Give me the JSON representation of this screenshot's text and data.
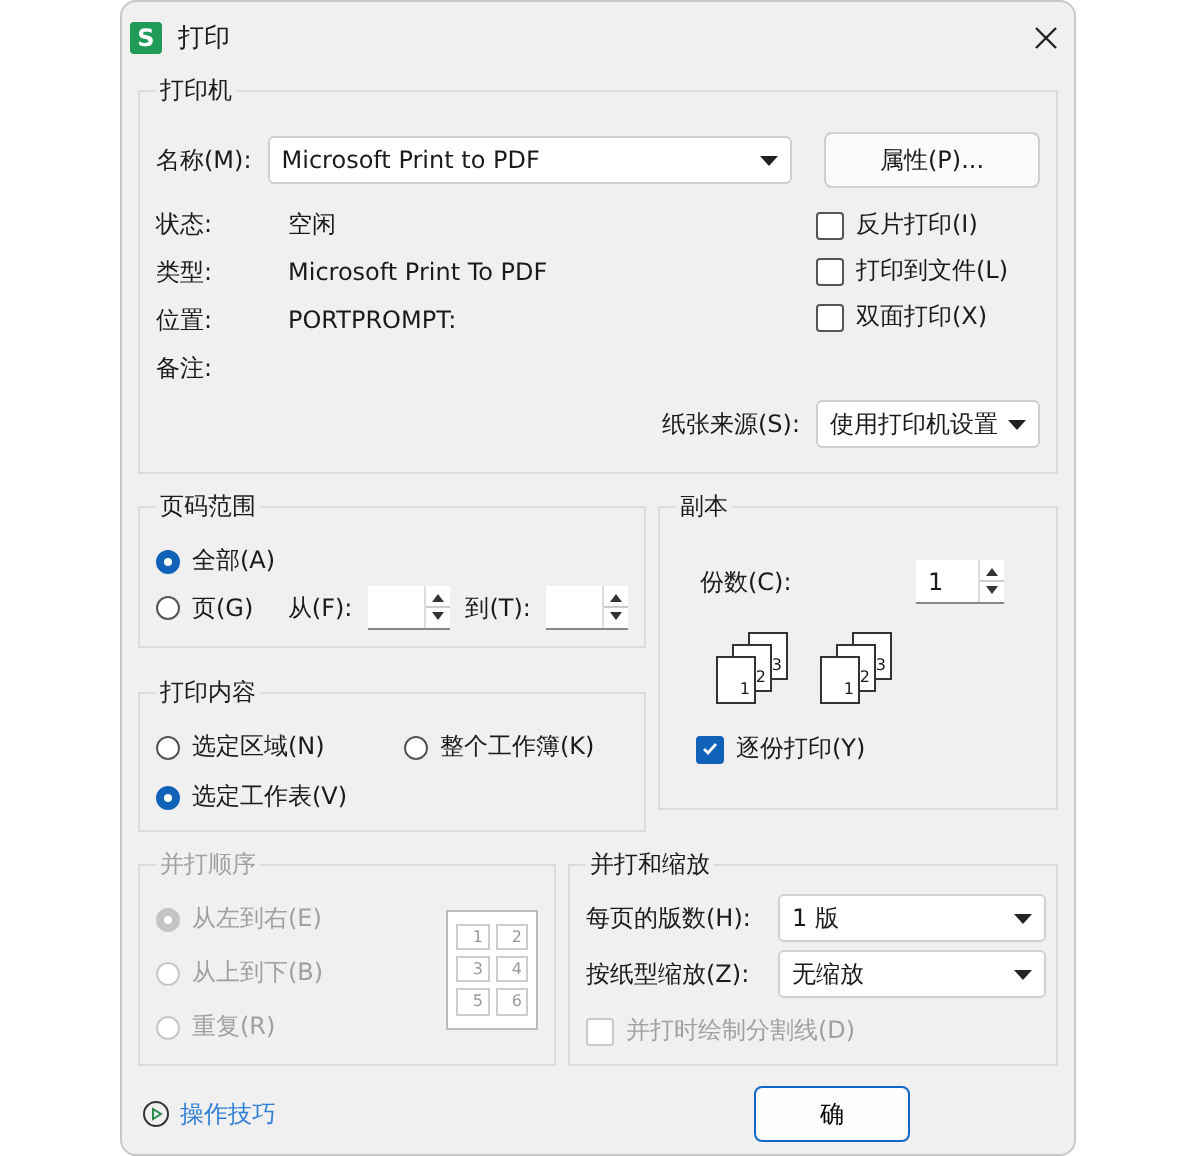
{
  "window": {
    "title": "打印",
    "app_icon": "S"
  },
  "printer": {
    "legend": "打印机",
    "name_label": "名称(M):",
    "name_value": "Microsoft Print to PDF",
    "properties_button": "属性(P)...",
    "info": [
      {
        "label": "状态:",
        "value": "空闲"
      },
      {
        "label": "类型:",
        "value": "Microsoft Print To PDF"
      },
      {
        "label": "位置:",
        "value": "PORTPROMPT:"
      },
      {
        "label": "备注:"
      }
    ],
    "options": [
      {
        "label": "反片打印(I)",
        "checked": false
      },
      {
        "label": "打印到文件(L)",
        "checked": false
      },
      {
        "label": "双面打印(X)",
        "checked": false
      }
    ],
    "paper_source_label": "纸张来源(S):",
    "paper_source_value": "使用打印机设置"
  },
  "page_range": {
    "legend": "页码范围",
    "options": [
      {
        "label": "全部(A)",
        "selected": true
      },
      {
        "label": "页(G)",
        "selected": false
      }
    ],
    "from_label": "从(F):",
    "to_label": "到(T):"
  },
  "copies": {
    "legend": "副本",
    "count_label": "份数(C):",
    "count_value": "1",
    "collate_icons": [
      {
        "pages": [
          "1",
          "2",
          "3"
        ]
      },
      {
        "pages": [
          "1",
          "2",
          "3"
        ]
      }
    ],
    "collate": {
      "label": "逐份打印(Y)",
      "checked": true
    }
  },
  "print_content": {
    "legend": "打印内容",
    "options": [
      {
        "label": "选定区域(N)",
        "selected": false
      },
      {
        "label": "整个工作簿(K)",
        "selected": false
      },
      {
        "label": "选定工作表(V)",
        "selected": true
      }
    ]
  },
  "order": {
    "legend": "并打顺序",
    "disabled": true,
    "options": [
      {
        "label": "从左到右(E)",
        "selected": true
      },
      {
        "label": "从上到下(B)",
        "selected": false
      },
      {
        "label": "重复(R)",
        "selected": false
      }
    ],
    "preview_numbers": [
      "1",
      "2",
      "3",
      "4",
      "5",
      "6"
    ]
  },
  "zoom": {
    "legend": "并打和缩放",
    "pages_label": "每页的版数(H):",
    "pages_value": "1 版",
    "scale_label": "按纸型缩放(Z):",
    "scale_value": "无缩放",
    "divider": {
      "label": "并打时绘制分割线(D)",
      "checked": false,
      "disabled": true
    }
  },
  "footer": {
    "tips_link": "操作技巧",
    "ok_button": "确"
  }
}
